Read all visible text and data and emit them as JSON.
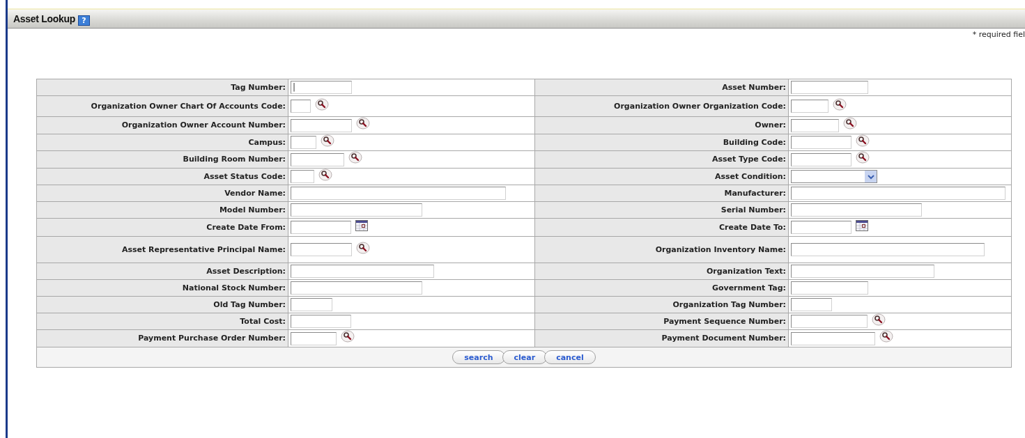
{
  "header": {
    "title": "Asset Lookup",
    "help_icon": "?"
  },
  "required_note": "* required fiel",
  "rows": [
    [
      {
        "label": "Tag Number:",
        "kind": "text",
        "value": "|"
      },
      {
        "label": "Asset Number:",
        "kind": "text"
      }
    ],
    [
      {
        "label": "Organization Owner Chart Of Accounts Code:",
        "kind": "lookup"
      },
      {
        "label": "Organization Owner Organization Code:",
        "kind": "lookup"
      }
    ],
    [
      {
        "label": "Organization Owner Account Number:",
        "kind": "lookup"
      },
      {
        "label": "Owner:",
        "kind": "lookup"
      }
    ],
    [
      {
        "label": "Campus:",
        "kind": "lookup"
      },
      {
        "label": "Building Code:",
        "kind": "lookup"
      }
    ],
    [
      {
        "label": "Building Room Number:",
        "kind": "lookup"
      },
      {
        "label": "Asset Type Code:",
        "kind": "lookup"
      }
    ],
    [
      {
        "label": "Asset Status Code:",
        "kind": "lookup"
      },
      {
        "label": "Asset Condition:",
        "kind": "select"
      }
    ],
    [
      {
        "label": "Vendor Name:",
        "kind": "text"
      },
      {
        "label": "Manufacturer:",
        "kind": "text"
      }
    ],
    [
      {
        "label": "Model Number:",
        "kind": "text"
      },
      {
        "label": "Serial Number:",
        "kind": "text"
      }
    ],
    [
      {
        "label": "Create Date From:",
        "kind": "date"
      },
      {
        "label": "Create Date To:",
        "kind": "date"
      }
    ],
    [
      {
        "label": "Asset Representative Principal Name:",
        "kind": "lookup"
      },
      {
        "label": "Organization Inventory Name:",
        "kind": "text"
      }
    ],
    [
      {
        "label": "Asset Description:",
        "kind": "text"
      },
      {
        "label": "Organization Text:",
        "kind": "text"
      }
    ],
    [
      {
        "label": "National Stock Number:",
        "kind": "text"
      },
      {
        "label": "Government Tag:",
        "kind": "text"
      }
    ],
    [
      {
        "label": "Old Tag Number:",
        "kind": "text"
      },
      {
        "label": "Organization Tag Number:",
        "kind": "text"
      }
    ],
    [
      {
        "label": "Total Cost:",
        "kind": "text"
      },
      {
        "label": "Payment Sequence Number:",
        "kind": "lookup"
      }
    ],
    [
      {
        "label": "Payment Purchase Order Number:",
        "kind": "lookup"
      },
      {
        "label": "Payment Document Number:",
        "kind": "lookup"
      }
    ]
  ],
  "buttons": [
    "search",
    "clear",
    "cancel"
  ]
}
